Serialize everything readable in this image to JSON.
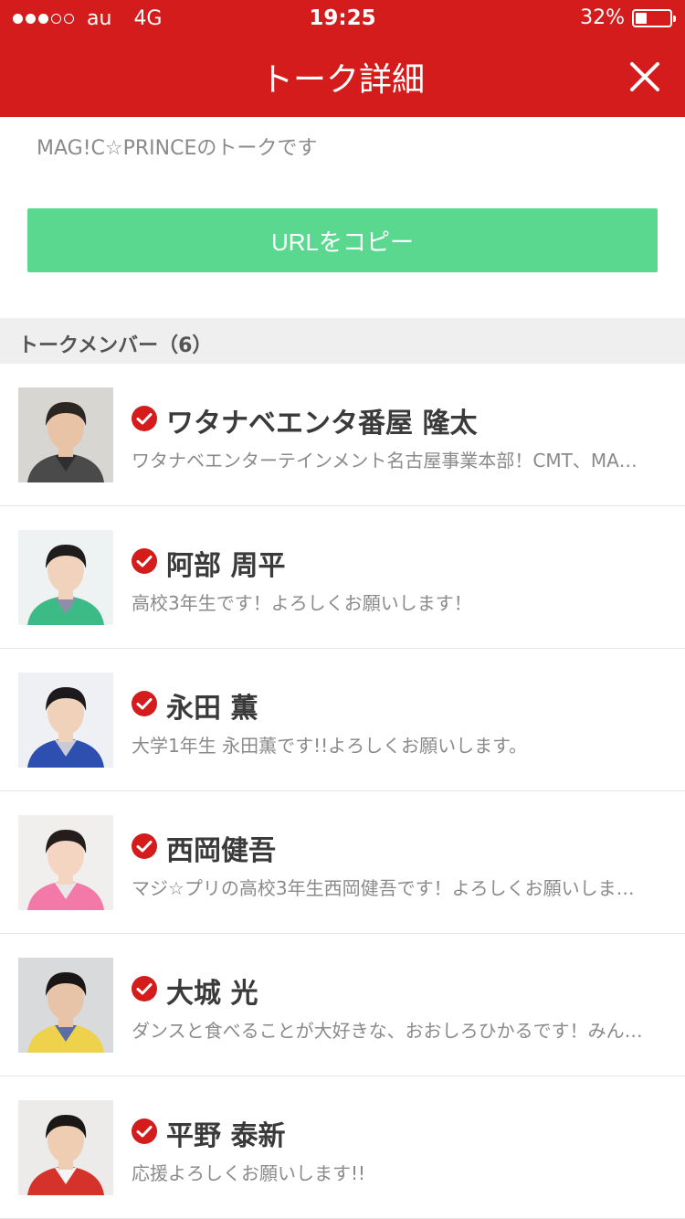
{
  "status_bar": {
    "carrier": "au",
    "network": "4G",
    "time": "19:25",
    "battery": "32%",
    "battery_level": 0.32,
    "signal_bars_filled": 3,
    "signal_bars_total": 5
  },
  "nav": {
    "title": "トーク詳細",
    "close_icon": "close-icon"
  },
  "description": "MAG!C☆PRINCEのトークです",
  "copy_button": "URLをコピー",
  "members_section": {
    "title": "トークメンバー（6）"
  },
  "members": [
    {
      "name": "ワタナベエンタ番屋 隆太",
      "desc": "ワタナベエンターテインメント名古屋事業本部！CMT、MA…",
      "verified_icon": "verified-check-icon"
    },
    {
      "name": "阿部 周平",
      "desc": "高校3年生です！よろしくお願いします！",
      "verified_icon": "verified-check-icon"
    },
    {
      "name": "永田 薫",
      "desc": "大学1年生 永田薫です!!よろしくお願いします。",
      "verified_icon": "verified-check-icon"
    },
    {
      "name": "西岡健吾",
      "desc": "マジ☆プリの高校3年生西岡健吾です！よろしくお願いしま…",
      "verified_icon": "verified-check-icon"
    },
    {
      "name": "大城 光",
      "desc": "ダンスと食べることが大好きな、おおしろひかるです！みん…",
      "verified_icon": "verified-check-icon"
    },
    {
      "name": "平野 泰新",
      "desc": "応援よろしくお願いします!!",
      "verified_icon": "verified-check-icon"
    }
  ],
  "colors": {
    "header": "#d41c1c",
    "copy_button": "#5ad88f",
    "verified": "#d41c1c"
  }
}
